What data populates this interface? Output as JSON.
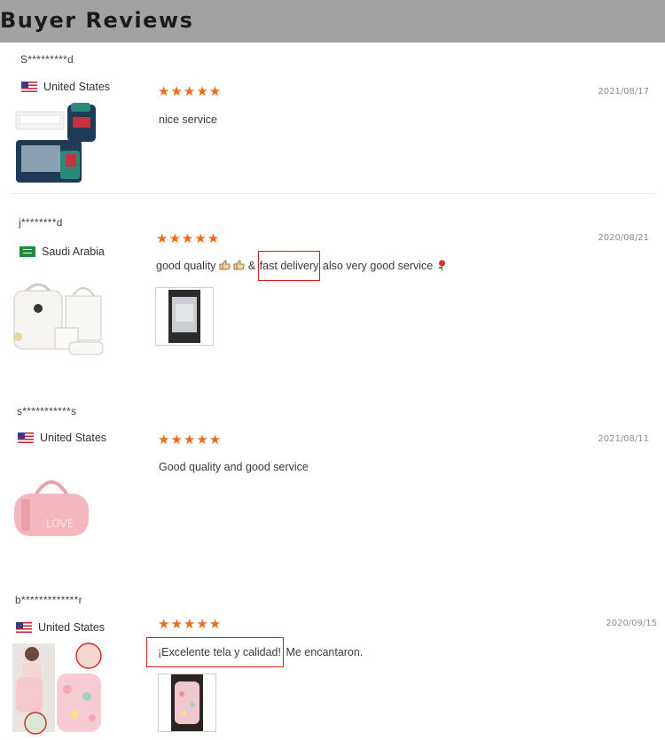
{
  "header": {
    "title": "Buyer Reviews"
  },
  "reviews": [
    {
      "user": "S*********d",
      "country": "United States",
      "flag_icon": "us-flag-icon",
      "stars": "★★★★★",
      "date": "2021/08/17",
      "comment": "nice service",
      "product_icon": "diaper-bag-bed-image"
    },
    {
      "user": "j********d",
      "country": "Saudi Arabia",
      "flag_icon": "sa-flag-icon",
      "stars": "★★★★★",
      "date": "2020/08/21",
      "comment_part1": "good quality",
      "comment_amp": "&",
      "comment_highlight": "fast delivery",
      "comment_part2": "also very good service",
      "product_icon": "backpack-set-image"
    },
    {
      "user": "s***********s",
      "country": "United States",
      "flag_icon": "us-flag-icon",
      "stars": "★★★★★",
      "date": "2021/08/11",
      "comment": "Good quality and good service",
      "product_icon": "pink-duffel-bag-image"
    },
    {
      "user": "b*************r",
      "country": "United States",
      "flag_icon": "us-flag-icon",
      "stars": "★★★★★",
      "date": "2020/09/15",
      "comment_highlight": "¡Excelente tela y calidad!",
      "comment_part2": "Me encantaron.",
      "product_icon": "floral-backpack-image"
    }
  ],
  "colors": {
    "star": "#f06b16",
    "highlight_box": "#d81d1d",
    "header_bg": "#a3a1a2"
  }
}
